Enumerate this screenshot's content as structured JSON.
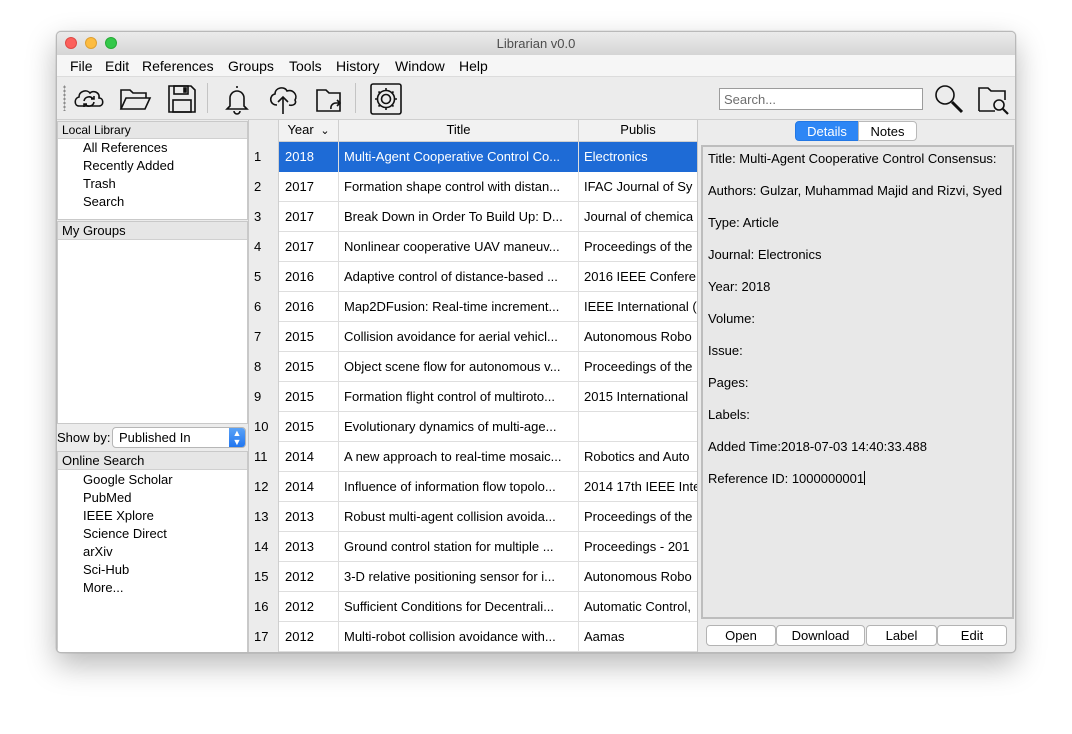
{
  "window": {
    "title": "Librarian v0.0"
  },
  "menu": [
    "File",
    "Edit",
    "References",
    "Groups",
    "Tools",
    "History",
    "Window",
    "Help"
  ],
  "toolbar": {
    "icons": [
      "sync-icon",
      "open-folder-icon",
      "save-icon",
      "bell-icon",
      "cloud-upload-icon",
      "export-folder-icon",
      "settings-gear-icon"
    ],
    "search_placeholder": "Search..."
  },
  "sidebar": {
    "local_header": "Local Library",
    "local_items": [
      "All References",
      "Recently Added",
      "Trash",
      "Search"
    ],
    "groups_header": "My Groups",
    "show_by_label": "Show by:",
    "show_by_value": "Published In",
    "online_header": "Online Search",
    "online_items": [
      "Google Scholar",
      "PubMed",
      "IEEE Xplore",
      "Science Direct",
      "arXiv",
      "Sci-Hub",
      "More..."
    ]
  },
  "table": {
    "columns": [
      "",
      "Year",
      "Title",
      "Publis"
    ],
    "sort_indicator": "⌄",
    "rows": [
      {
        "num": "1",
        "year": "2018",
        "title": "Multi-Agent Cooperative Control Co...",
        "pub": "Electronics"
      },
      {
        "num": "2",
        "year": "2017",
        "title": "Formation shape control with distan...",
        "pub": "IFAC Journal of Sy"
      },
      {
        "num": "3",
        "year": "2017",
        "title": "Break Down in Order To Build Up: D...",
        "pub": "Journal of chemica"
      },
      {
        "num": "4",
        "year": "2017",
        "title": "Nonlinear cooperative UAV maneuv...",
        "pub": "Proceedings of the"
      },
      {
        "num": "5",
        "year": "2016",
        "title": "Adaptive control of distance-based ...",
        "pub": "2016 IEEE Confere"
      },
      {
        "num": "6",
        "year": "2016",
        "title": "Map2DFusion: Real-time increment...",
        "pub": "IEEE International ("
      },
      {
        "num": "7",
        "year": "2015",
        "title": "Collision avoidance for aerial vehicl...",
        "pub": "Autonomous Robo"
      },
      {
        "num": "8",
        "year": "2015",
        "title": "Object scene flow for autonomous v...",
        "pub": "Proceedings of the"
      },
      {
        "num": "9",
        "year": "2015",
        "title": "Formation flight control of multiroto...",
        "pub": "2015 International"
      },
      {
        "num": "10",
        "year": "2015",
        "title": "Evolutionary dynamics of multi-age...",
        "pub": ""
      },
      {
        "num": "11",
        "year": "2014",
        "title": "A new approach to real-time mosaic...",
        "pub": "Robotics and Auto"
      },
      {
        "num": "12",
        "year": "2014",
        "title": "Influence of information flow topolo...",
        "pub": "2014 17th IEEE Inte"
      },
      {
        "num": "13",
        "year": "2013",
        "title": "Robust multi-agent collision avoida...",
        "pub": "Proceedings of the"
      },
      {
        "num": "14",
        "year": "2013",
        "title": "Ground control station for multiple ...",
        "pub": "Proceedings - 201"
      },
      {
        "num": "15",
        "year": "2012",
        "title": "3-D relative positioning sensor for i...",
        "pub": "Autonomous Robo"
      },
      {
        "num": "16",
        "year": "2012",
        "title": "Sufficient Conditions for Decentrali...",
        "pub": "Automatic Control,"
      },
      {
        "num": "17",
        "year": "2012",
        "title": "Multi-robot collision avoidance with...",
        "pub": "Aamas"
      }
    ]
  },
  "details": {
    "tabs": [
      "Details",
      "Notes"
    ],
    "lines": [
      "Title: Multi-Agent Cooperative Control Consensus:",
      "Authors: Gulzar, Muhammad Majid and Rizvi, Syed",
      "Type: Article",
      "Journal: Electronics",
      "Year: 2018",
      "Volume:",
      "Issue:",
      "Pages:",
      "Labels:",
      "Added Time:2018-07-03 14:40:33.488",
      "Reference ID: 1000000001"
    ],
    "buttons": [
      "Open",
      "Download",
      "Label",
      "Edit"
    ]
  }
}
